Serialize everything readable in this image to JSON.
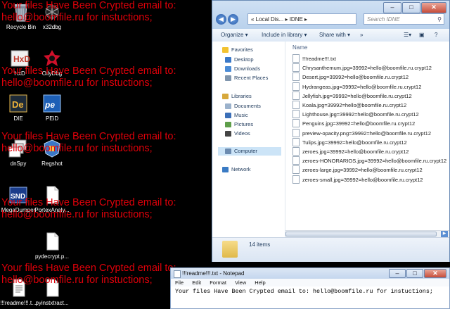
{
  "ransom_message": {
    "line1": "Your files Have Been Crypted email to:",
    "line2": "hello@boomfile.ru for instuctions;"
  },
  "desktop_icons": [
    {
      "label": "Recycle Bin"
    },
    {
      "label": "x32dbg"
    },
    {
      "label": "HxD"
    },
    {
      "label": "OllyDbg"
    },
    {
      "label": "DIE"
    },
    {
      "label": "PEiD"
    },
    {
      "label": "dnSpy"
    },
    {
      "label": "Regshot"
    },
    {
      "label": "MegaDumper"
    },
    {
      "label": "PortexAnaly..."
    },
    {
      "label": "pydecrypt.p..."
    },
    {
      "label": "!!!readme!!!.t..."
    },
    {
      "label": "pyinstxtract..."
    }
  ],
  "explorer": {
    "breadcrumb": "« Local Dis... ▸ IDNE ▸",
    "search_placeholder": "Search IDNE",
    "toolbar": {
      "organize": "Organize ▾",
      "include_in_library": "Include in library ▾",
      "share_with": "Share with ▾",
      "more": "»"
    },
    "nav": {
      "favorites": "Favorites",
      "desktop": "Desktop",
      "downloads": "Downloads",
      "recent_places": "Recent Places",
      "libraries": "Libraries",
      "documents": "Documents",
      "music": "Music",
      "pictures": "Pictures",
      "videos": "Videos",
      "computer": "Computer",
      "network": "Network"
    },
    "column_header": "Name",
    "files": [
      "!!!readme!!!.txt",
      "Chrysanthemum.jpg=39992=hello@boomfile.ru.crypt12",
      "Desert.jpg=39992=hello@boomfile.ru.crypt12",
      "Hydrangeas.jpg=39992=hello@boomfile.ru.crypt12",
      "Jellyfish.jpg=39992=hello@boomfile.ru.crypt12",
      "Koala.jpg=39992=hello@boomfile.ru.crypt12",
      "Lighthouse.jpg=39992=hello@boomfile.ru.crypt12",
      "Penguins.jpg=39992=hello@boomfile.ru.crypt12",
      "preview-opacity.png=39992=hello@boomfile.ru.crypt12",
      "Tulips.jpg=39992=hello@boomfile.ru.crypt12",
      "zeroes.jpg=39992=hello@boomfile.ru.crypt12",
      "zeroes-HONORARIOS.jpg=39992=hello@boomfile.ru.crypt12",
      "zeroes-large.jpg=39992=hello@boomfile.ru.crypt12",
      "zeroes-small.jpg=39992=hello@boomfile.ru.crypt12"
    ],
    "item_count": "14 items"
  },
  "notepad": {
    "title": "!!!readme!!!.txt - Notepad",
    "menu": [
      "File",
      "Edit",
      "Format",
      "View",
      "Help"
    ],
    "content": "Your files Have Been Crypted email to: hello@boomfile.ru for instuctions;"
  },
  "colors": {
    "ransom_text": "#e0000a",
    "desktop_bg": "#000000"
  }
}
